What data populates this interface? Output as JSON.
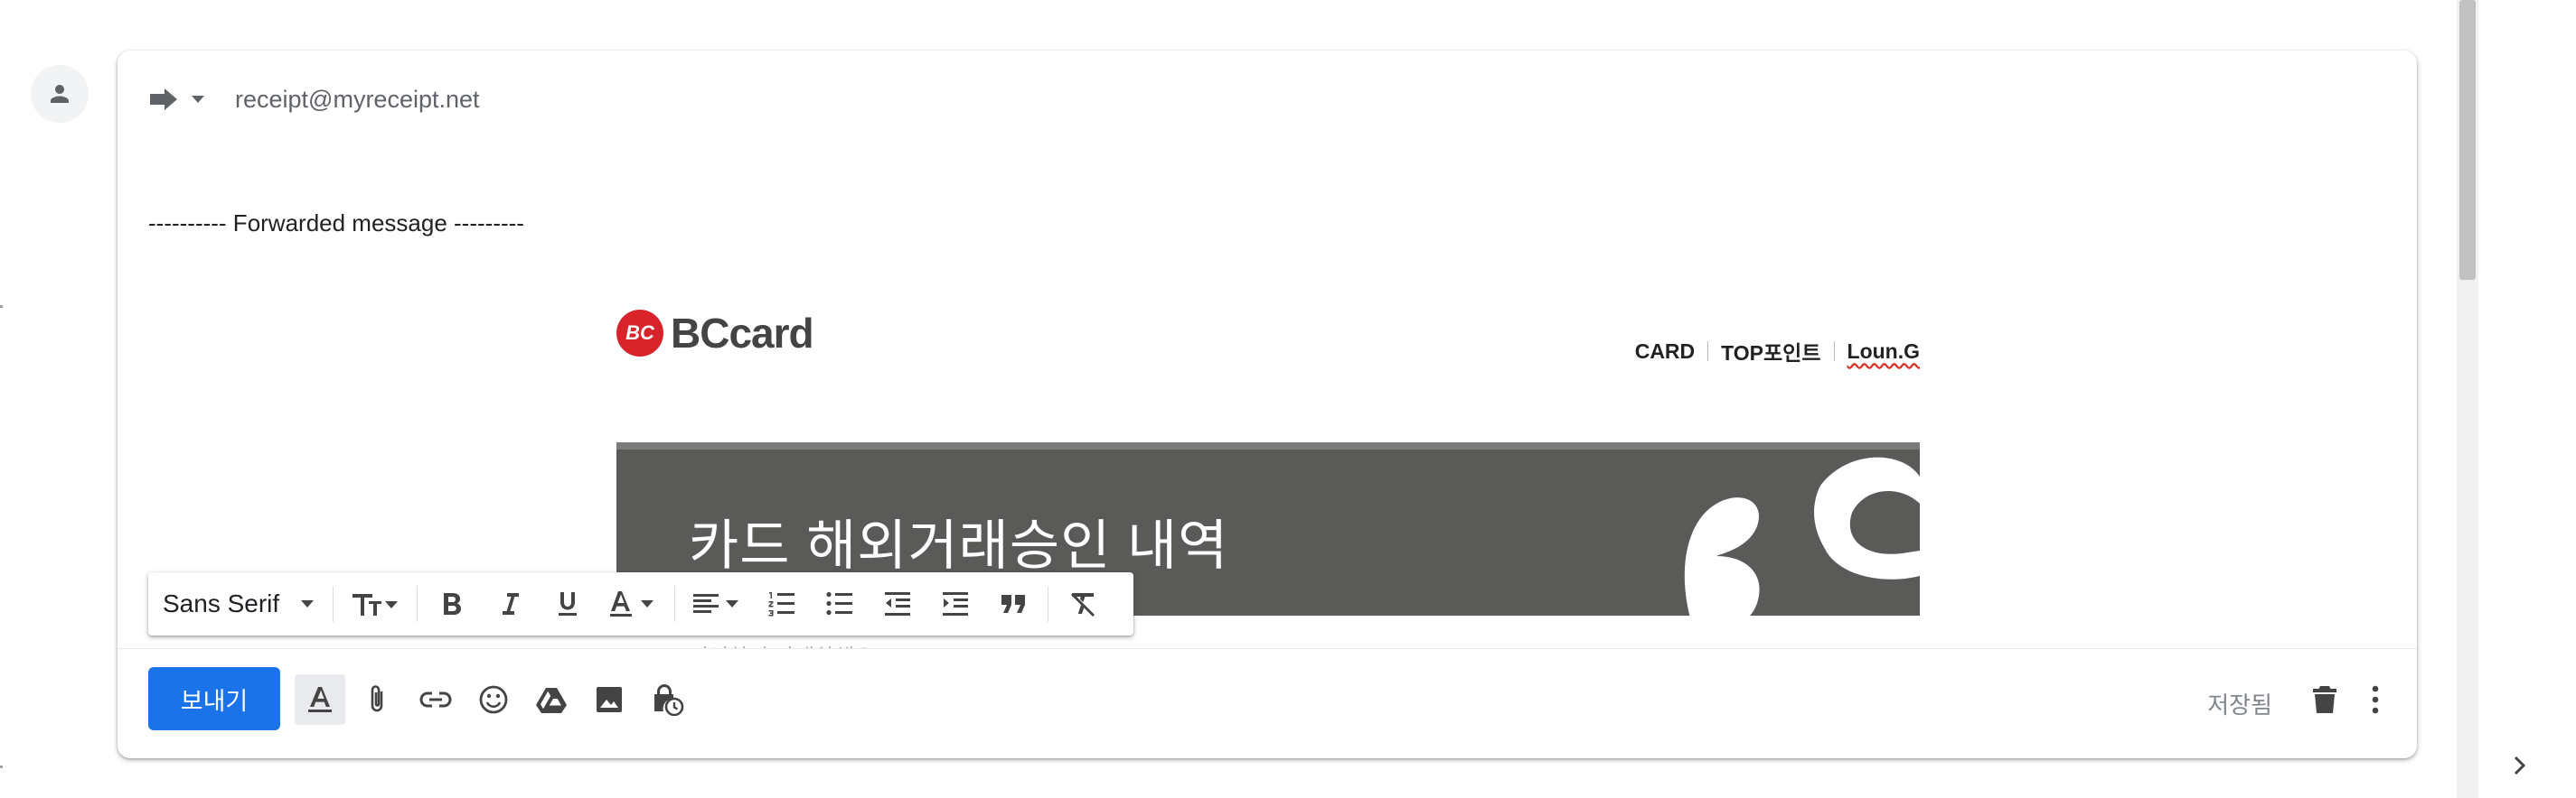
{
  "compose": {
    "recipient": "receipt@myreceipt.net",
    "forwarded_line": "---------- Forwarded message ---------"
  },
  "email_body": {
    "logo_text": "BCcard",
    "logo_mark_text": "BC",
    "top_nav": [
      "CARD",
      "TOP포인트",
      "Loun.G"
    ],
    "banner_title": "카드 해외거래승인 내역",
    "obscured_text": "거여하시 아내하해요"
  },
  "formatting_toolbar": {
    "font": "Sans Serif"
  },
  "bottom_bar": {
    "send_label": "보내기",
    "saved_status": "저장됨"
  },
  "colors": {
    "send_button": "#1a73e8",
    "bc_red": "#d8232a",
    "banner_bg": "#5a5a58"
  }
}
